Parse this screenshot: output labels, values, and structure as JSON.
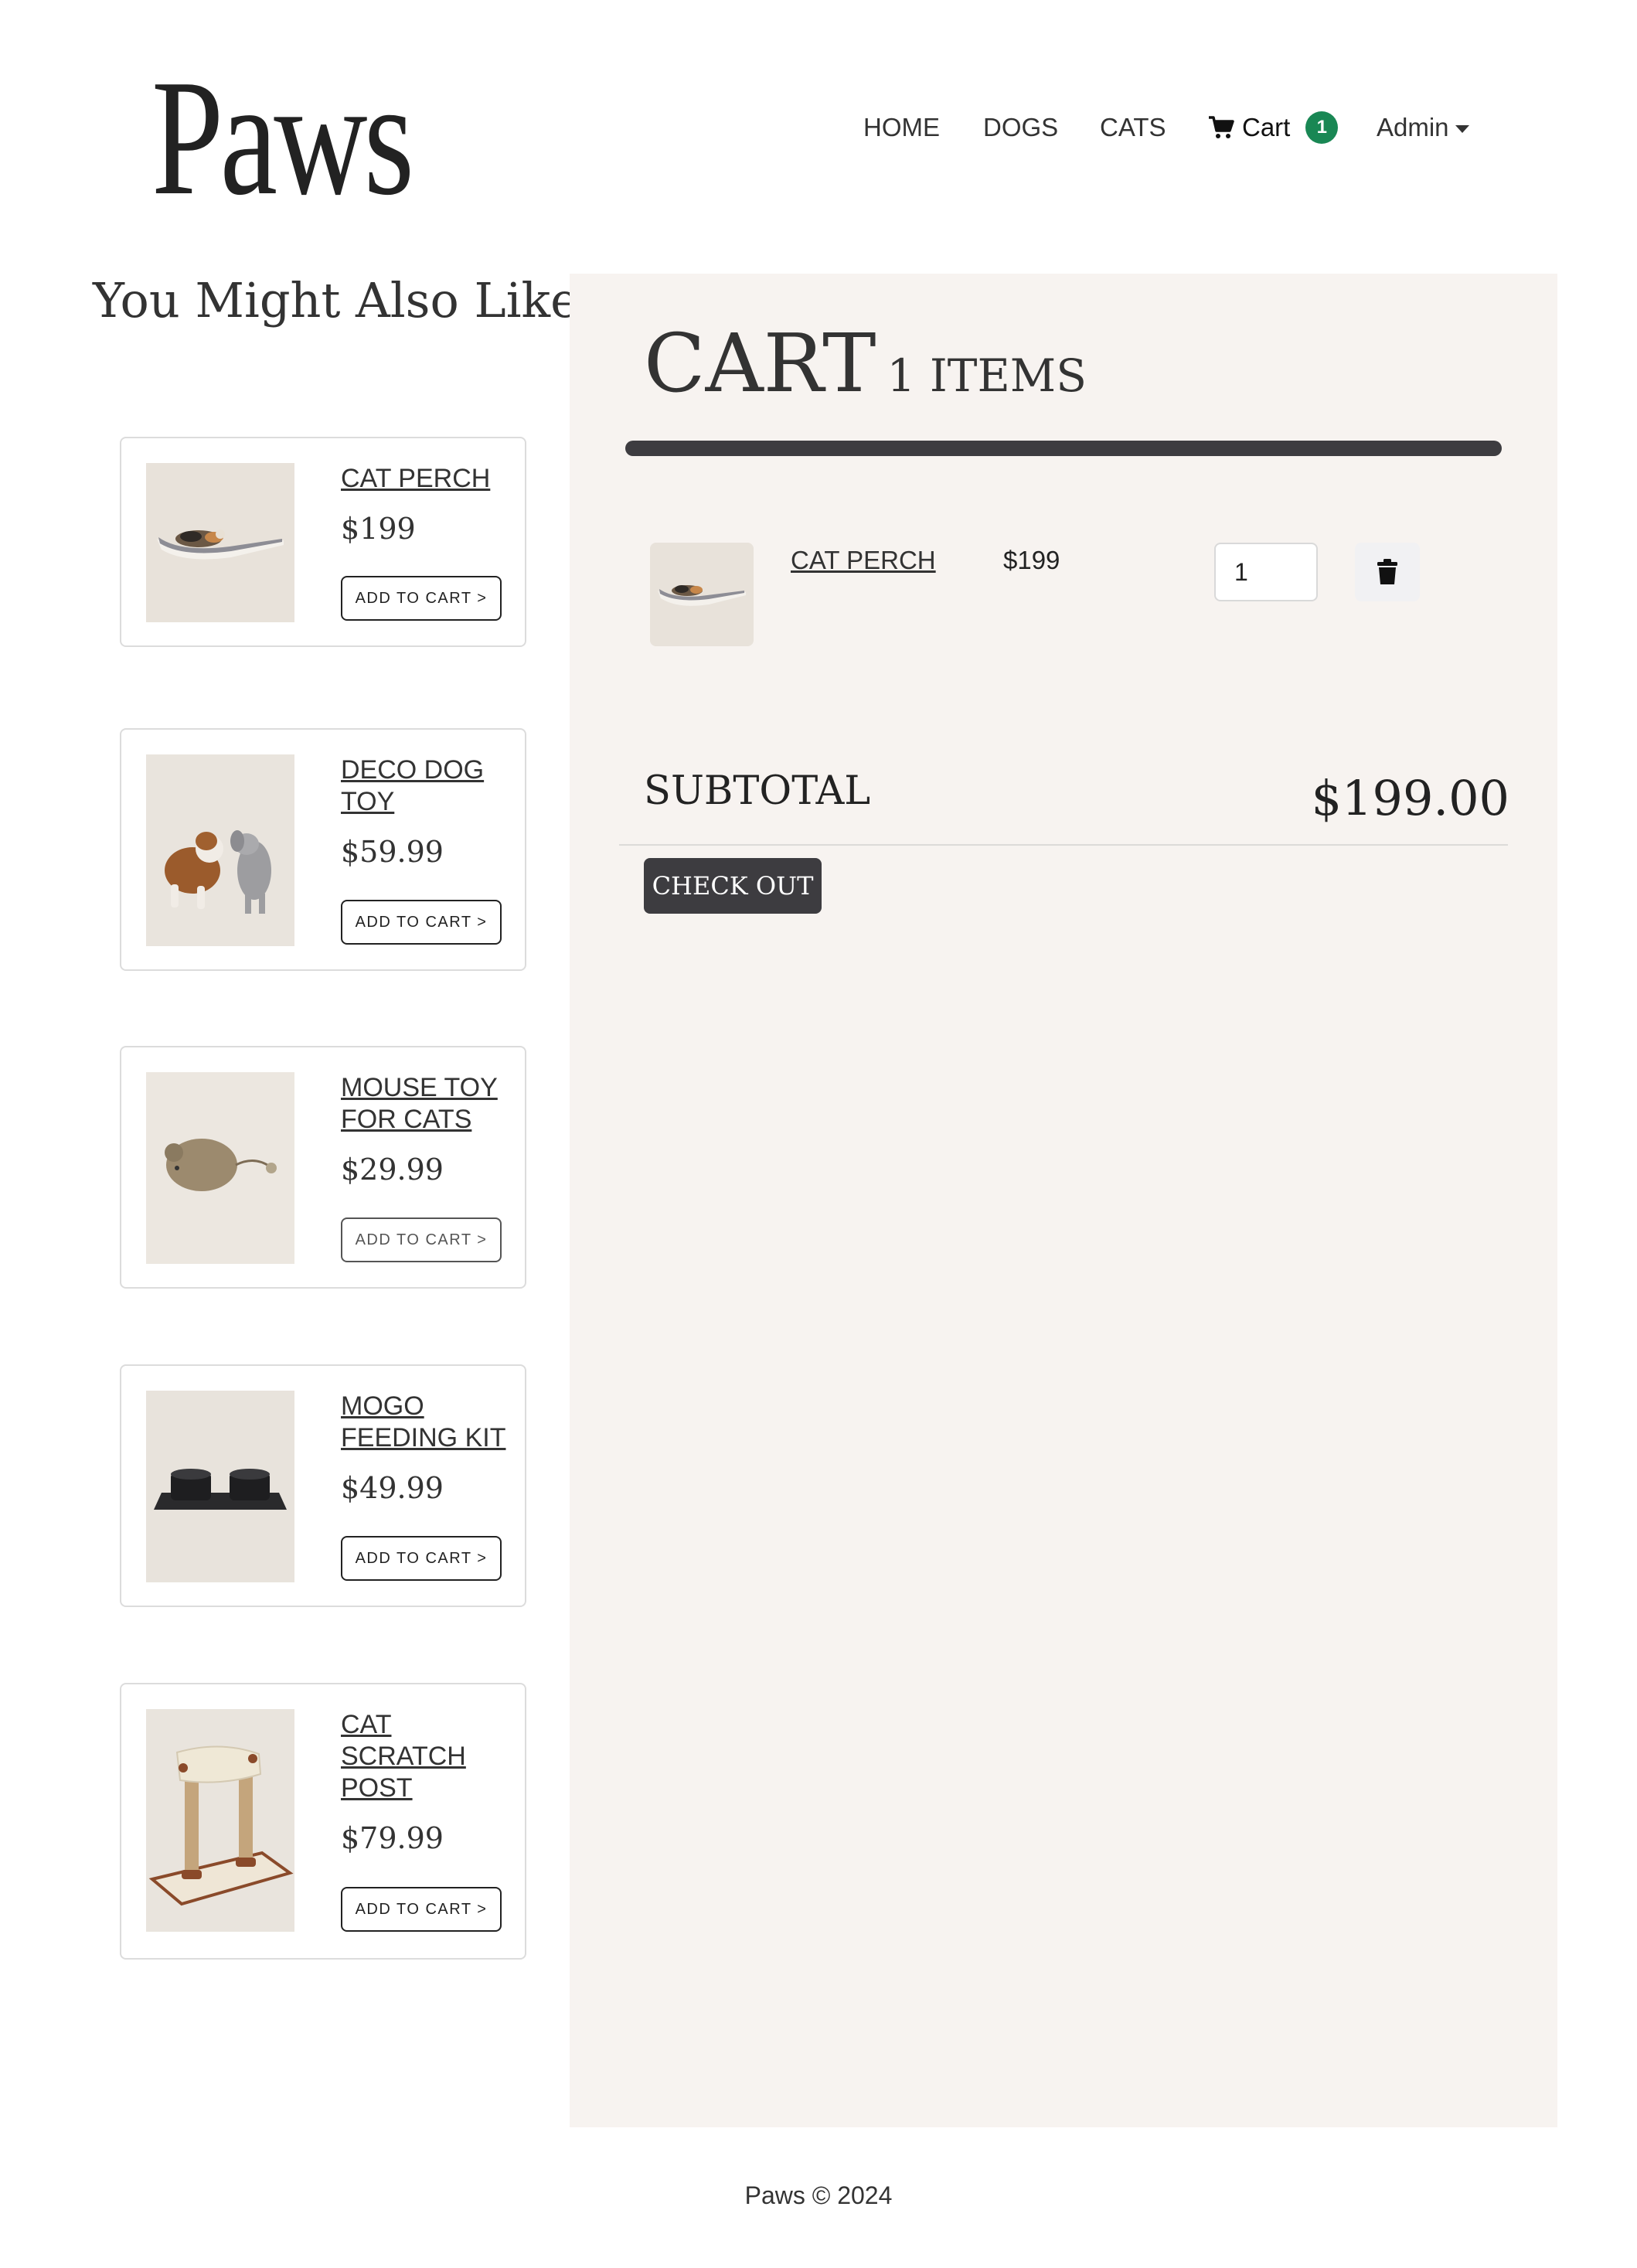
{
  "header": {
    "logo": "Paws",
    "nav": {
      "home": "HOME",
      "dogs": "DOGS",
      "cats": "CATS",
      "cart": "Cart",
      "cart_count": "1",
      "admin": "Admin"
    }
  },
  "sidebar": {
    "heading": "You Might Also Like",
    "products": [
      {
        "name": "CAT PERCH",
        "price": "$199",
        "button": "ADD TO CART >"
      },
      {
        "name": "DECO DOG TOY",
        "price": "$59.99",
        "button": "ADD TO CART >"
      },
      {
        "name": "MOUSE TOY FOR CATS",
        "price": "$29.99",
        "button": "ADD TO CART >"
      },
      {
        "name": "MOGO FEEDING KIT",
        "price": "$49.99",
        "button": "ADD TO CART >"
      },
      {
        "name": "CAT SCRATCH POST",
        "price": "$79.99",
        "button": "ADD TO CART >"
      }
    ]
  },
  "cart": {
    "title": "CART",
    "count_label": "1 ITEMS",
    "items": [
      {
        "name": "CAT PERCH",
        "price": "$199",
        "quantity": "1"
      }
    ],
    "subtotal_label": "SUBTOTAL",
    "subtotal_value": "$199.00",
    "checkout_label": "CHECK OUT"
  },
  "footer": {
    "text": "Paws © 2024"
  },
  "colors": {
    "accent_dark": "#3d3c40",
    "badge_green": "#198754",
    "panel_bg": "#f7f3f0"
  }
}
